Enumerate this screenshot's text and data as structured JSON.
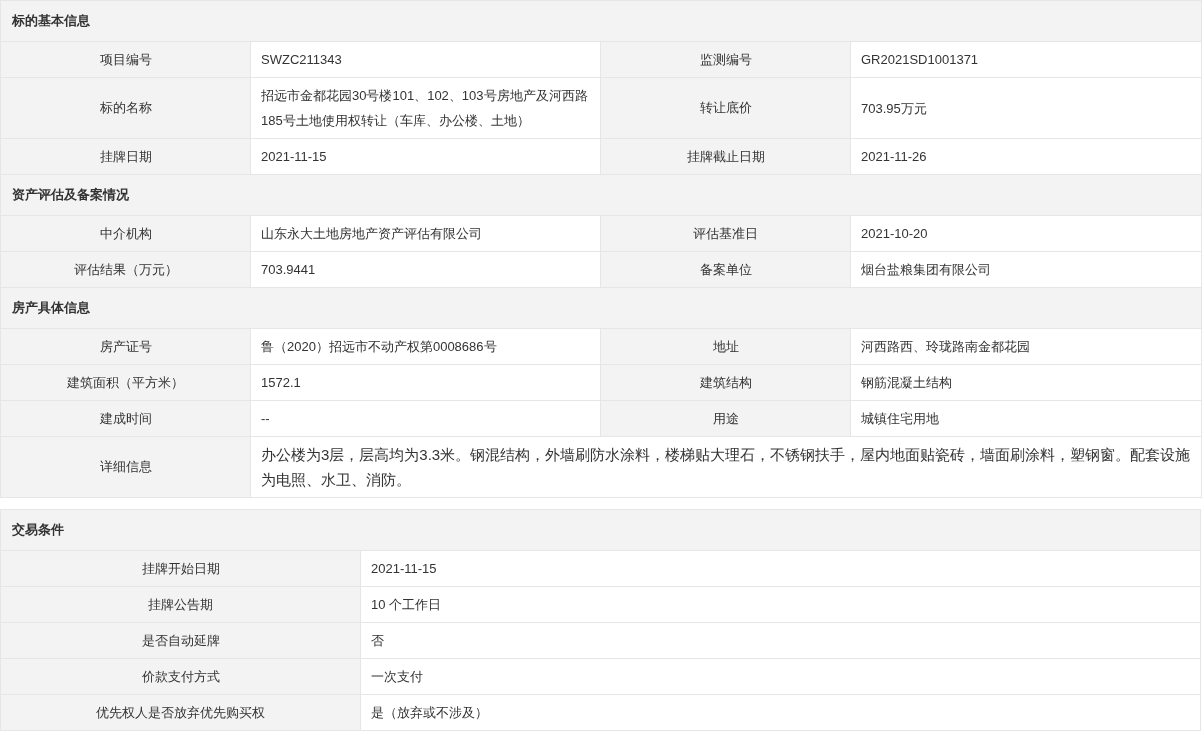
{
  "main_table": {
    "sections": [
      {
        "title": "标的基本信息",
        "rows": [
          {
            "fields": [
              {
                "label": "项目编号",
                "value": "SWZC211343"
              },
              {
                "label": "监测编号",
                "value": "GR2021SD1001371"
              }
            ]
          },
          {
            "fields": [
              {
                "label": "标的名称",
                "value": "招远市金都花园30号楼101、102、103号房地产及河西路185号土地使用权转让（车库、办公楼、土地）"
              },
              {
                "label": "转让底价",
                "value": "703.95万元"
              }
            ]
          },
          {
            "fields": [
              {
                "label": "挂牌日期",
                "value": "2021-11-15"
              },
              {
                "label": "挂牌截止日期",
                "value": "2021-11-26"
              }
            ]
          }
        ]
      },
      {
        "title": "资产评估及备案情况",
        "rows": [
          {
            "fields": [
              {
                "label": "中介机构",
                "value": "山东永大土地房地产资产评估有限公司"
              },
              {
                "label": "评估基准日",
                "value": "2021-10-20"
              }
            ]
          },
          {
            "fields": [
              {
                "label": "评估结果（万元）",
                "value": "703.9441"
              },
              {
                "label": "备案单位",
                "value": "烟台盐粮集团有限公司"
              }
            ]
          }
        ]
      },
      {
        "title": "房产具体信息",
        "rows": [
          {
            "fields": [
              {
                "label": "房产证号",
                "value": "鲁（2020）招远市不动产权第0008686号"
              },
              {
                "label": "地址",
                "value": "河西路西、玲珑路南金都花园"
              }
            ]
          },
          {
            "fields": [
              {
                "label": "建筑面积（平方米）",
                "value": "1572.1"
              },
              {
                "label": "建筑结构",
                "value": "钢筋混凝土结构"
              }
            ]
          },
          {
            "fields": [
              {
                "label": "建成时间",
                "value": "--"
              },
              {
                "label": "用途",
                "value": "城镇住宅用地"
              }
            ]
          },
          {
            "fields": [
              {
                "label": "详细信息",
                "value": "办公楼为3层，层高均为3.3米。钢混结构，外墙刷防水涂料，楼梯贴大理石，不锈钢扶手，屋内地面贴瓷砖，墙面刷涂料，塑钢窗。配套设施为电照、水卫、消防。"
              }
            ]
          }
        ]
      }
    ]
  },
  "trade_table": {
    "title": "交易条件",
    "rows": [
      {
        "label": "挂牌开始日期",
        "value": "2021-11-15"
      },
      {
        "label": "挂牌公告期",
        "value": "10 个工作日"
      },
      {
        "label": "是否自动延牌",
        "value": "否"
      },
      {
        "label": "价款支付方式",
        "value": "一次支付"
      },
      {
        "label": "优先权人是否放弃优先购买权",
        "value": "是（放弃或不涉及）"
      }
    ]
  }
}
